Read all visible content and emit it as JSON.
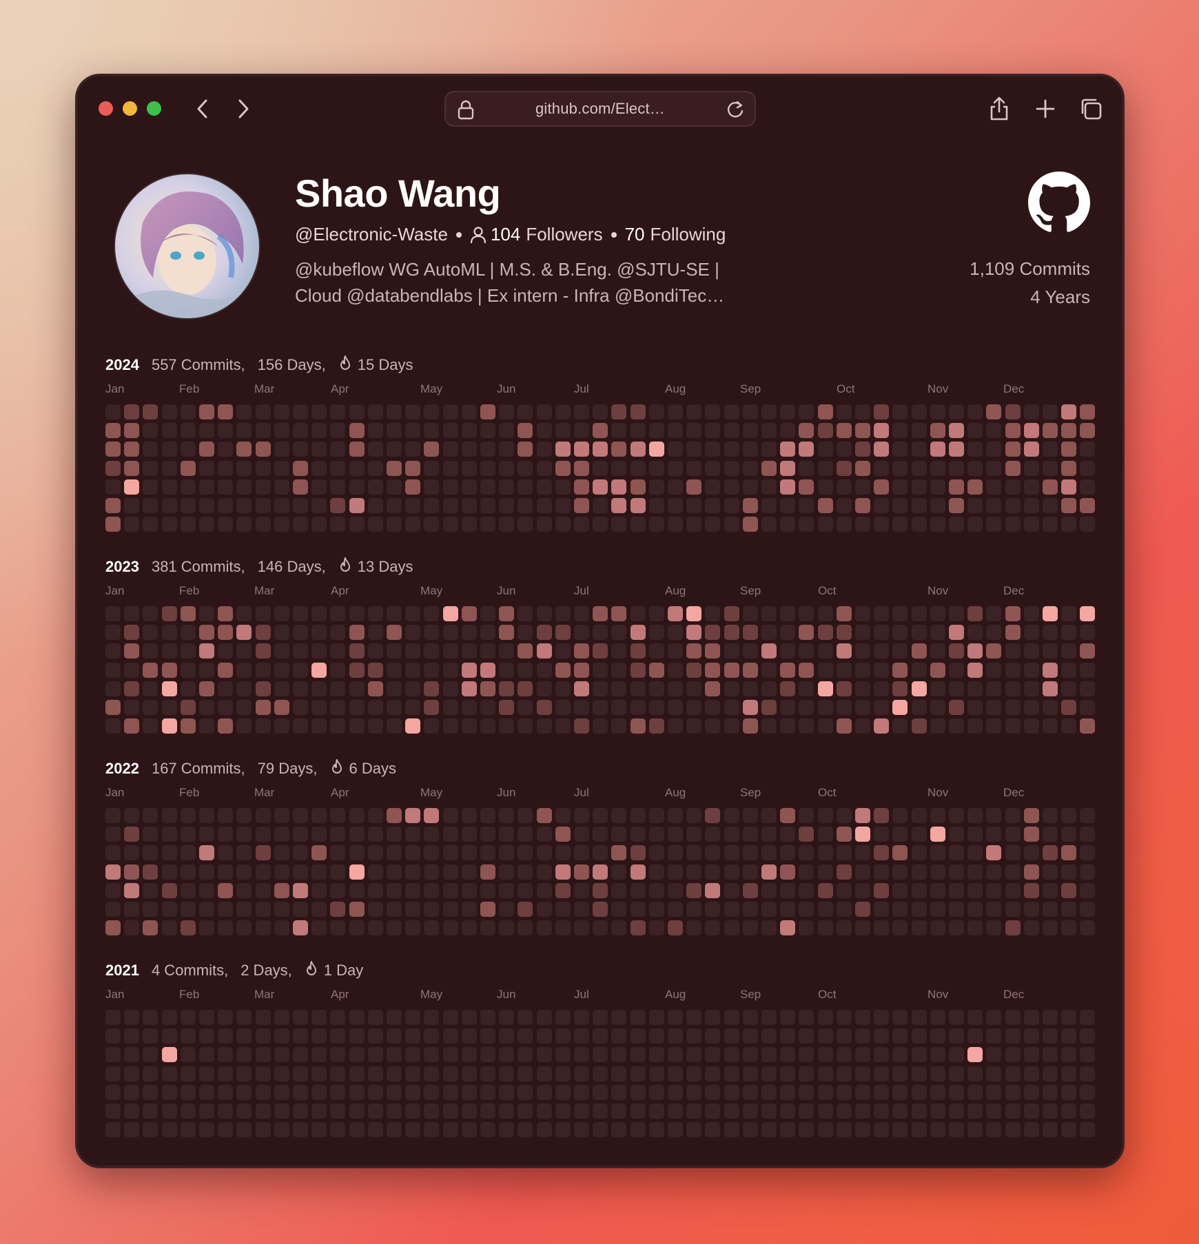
{
  "browser": {
    "url": "github.com/Elect…",
    "buttons": [
      "back",
      "forward",
      "share",
      "new-tab",
      "tabs-overview"
    ]
  },
  "profile": {
    "name": "Shao Wang",
    "handle": "@Electronic-Waste",
    "followers_count": "104",
    "followers_label": "Followers",
    "following_count": "70",
    "following_label": "Following",
    "bio_line1": "@kubeflow WG AutoML | M.S. & B.Eng. @SJTU-SE |",
    "bio_line2": "Cloud @databendlabs | Ex intern - Infra @BondiTec…",
    "total_commits": "1,109 Commits",
    "total_years": "4 Years"
  },
  "colors": {
    "level0": "#3b2224",
    "level1": "#6e3f3f",
    "level2": "#8f5552",
    "level3": "#c1797a",
    "level4": "#f4a6a0"
  },
  "months": [
    "Jan",
    "Feb",
    "Mar",
    "Apr",
    "May",
    "Jun",
    "Jul",
    "Aug",
    "Sep",
    "Oct",
    "Nov",
    "Dec"
  ],
  "years": [
    {
      "year": "2024",
      "commits": "557 Commits,",
      "days": "156 Days,",
      "streak": "15 Days",
      "cells": [
        "0110022000000000000020000001100000000020010000021003202200",
        "2200000000000200000000200020000000000212230023002322240340",
        "2200020220000200020000203332340000003300130033002302024440",
        "1200200000200002200000002200000000023001200000002002022000",
        "0400000000200000200000000233200200003200020002200023003330",
        "2000000000001300000000000203300000200020200002000002230000",
        "2000000000000000000000000000000000200000000000000000000000"
      ]
    },
    {
      "year": "2023",
      "commits": "381 Commits,",
      "days": "146 Days,",
      "streak": "13 Days",
      "cells": [],
      "cells_note": "levels per day"
    },
    {
      "year": "2022",
      "commits": "167 Commits,",
      "days": "79 Days,",
      "streak": "6 Days",
      "cells": []
    },
    {
      "year": "2021",
      "commits": "4 Commits,",
      "days": "2 Days,",
      "streak": "1 Day",
      "cells": []
    }
  ]
}
